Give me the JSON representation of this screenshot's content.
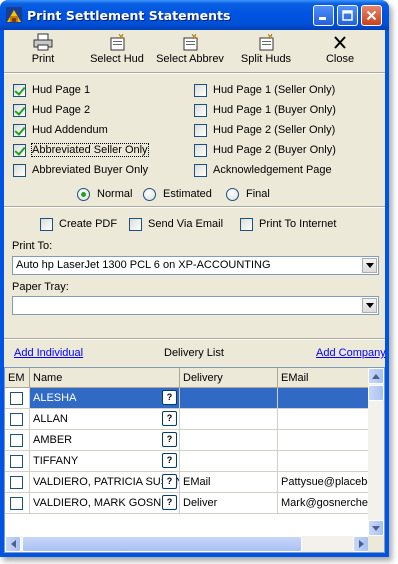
{
  "window": {
    "title": "Print Settlement Statements"
  },
  "toolbar": {
    "print": "Print",
    "select_hud": "Select Hud",
    "select_abbrev": "Select Abbrev",
    "split_huds": "Split Huds",
    "close": "Close"
  },
  "options": {
    "left": [
      {
        "label": "Hud Page 1",
        "checked": true
      },
      {
        "label": "Hud Page 2",
        "checked": true
      },
      {
        "label": "Hud Addendum",
        "checked": true
      },
      {
        "label": "Abbreviated Seller Only",
        "checked": true
      },
      {
        "label": "Abbreviated Buyer Only",
        "checked": false
      }
    ],
    "right": [
      {
        "label": "Hud Page 1 (Seller Only)",
        "checked": false
      },
      {
        "label": "Hud Page 1 (Buyer Only)",
        "checked": false
      },
      {
        "label": "Hud Page 2 (Seller Only)",
        "checked": false
      },
      {
        "label": "Hud Page 2 (Buyer Only)",
        "checked": false
      },
      {
        "label": "Acknowledgement Page",
        "checked": false
      }
    ]
  },
  "mode": {
    "options": [
      "Normal",
      "Estimated",
      "Final"
    ],
    "selected": "Normal"
  },
  "output": {
    "create_pdf": "Create PDF",
    "send_via_email": "Send Via Email",
    "print_to_internet": "Print To Internet"
  },
  "print_to": {
    "label": "Print To:",
    "value": "Auto hp LaserJet 1300 PCL 6 on XP-ACCOUNTING"
  },
  "paper_tray": {
    "label": "Paper Tray:",
    "value": ""
  },
  "delivery": {
    "add_individual": "Add Individual",
    "title": "Delivery List",
    "add_company": "Add Company",
    "columns": [
      "EM",
      "Name",
      "Delivery",
      "EMail"
    ],
    "rows": [
      {
        "name": "ALESHA",
        "delivery": "",
        "email": "",
        "selected": true
      },
      {
        "name": "ALLAN",
        "delivery": "",
        "email": ""
      },
      {
        "name": "AMBER",
        "delivery": "",
        "email": ""
      },
      {
        "name": "TIFFANY",
        "delivery": "",
        "email": ""
      },
      {
        "name": "VALDIERO, PATRICIA SUSAN",
        "delivery": "EMail",
        "email": "Pattysue@placebo"
      },
      {
        "name": "VALDIERO, MARK GOSNER",
        "delivery": "Deliver",
        "email": "Mark@gosnercheer"
      }
    ],
    "help_glyph": "?"
  },
  "colors": {
    "title_bar": "#0054e3",
    "client_bg": "#ece9d8",
    "selection": "#316ac5",
    "link": "#0000ff",
    "check": "#21a121"
  }
}
